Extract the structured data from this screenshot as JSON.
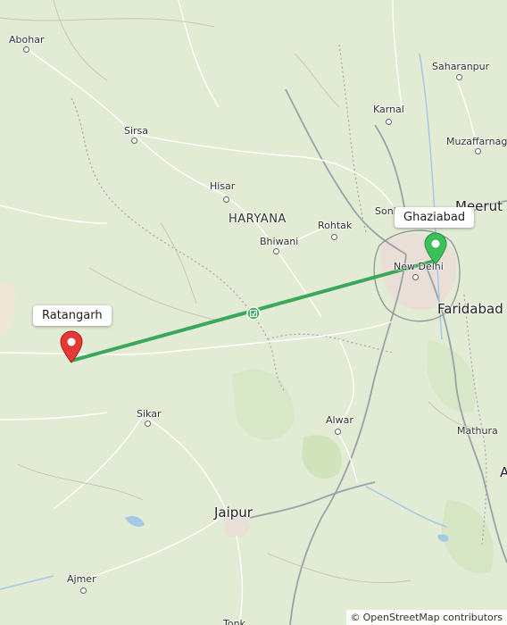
{
  "map": {
    "places": {
      "abohar": "Abohar",
      "sirsa": "Sirsa",
      "hisar": "Hisar",
      "haryana": "HARYANA",
      "bhiwani": "Bhiwani",
      "rohtak": "Rohtak",
      "sonipat": "Soni",
      "karnal": "Karnal",
      "saharanpur": "Saharanpur",
      "muzaffarnagar": "Muzaffarnaga",
      "meerut": "Meerut",
      "new_delhi": "New Delhi",
      "faridabad": "Faridabad",
      "sikar": "Sikar",
      "alwar": "Alwar",
      "mathura": "Mathura",
      "jaipur": "Jaipur",
      "ajmer": "Ajmer",
      "tonk": "Tonk",
      "edge_a": "A"
    },
    "route": {
      "start_label": "Ratangarh",
      "end_label": "Ghaziabad",
      "start_pin_color": "#e53935",
      "end_pin_color": "#3cc05a",
      "line_color": "#3aa85a",
      "midpoint_icon": "route-badge-icon"
    },
    "attribution": {
      "symbol": "©",
      "text": "OpenStreetMap contributors"
    }
  }
}
